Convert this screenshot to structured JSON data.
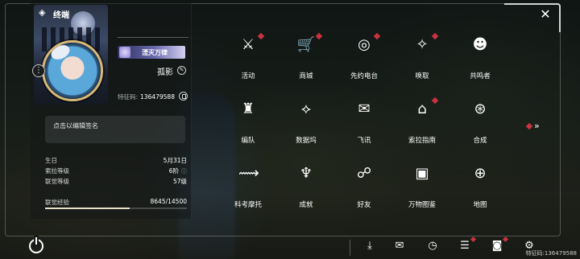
{
  "profile": {
    "title": "终端",
    "badge": "湮灭万律",
    "name": "孤影",
    "uid_label": "特征码:",
    "uid_value": "136479588",
    "signature_placeholder": "点击以编辑签名",
    "stats": [
      {
        "label": "生日",
        "value": "5月31日"
      },
      {
        "label": "索拉等级",
        "value": "6阶"
      },
      {
        "label": "联觉等级",
        "value": "57级"
      }
    ],
    "xp": {
      "label": "联觉经验",
      "value": "8645/14500",
      "fraction": 0.596
    }
  },
  "menu": {
    "items": [
      {
        "label": "活动",
        "icon": "activity-icon",
        "glyph": "⚔",
        "dot": true
      },
      {
        "label": "商城",
        "icon": "shop-cart-icon",
        "glyph": "🛒",
        "dot": true
      },
      {
        "label": "先约电台",
        "icon": "radio-icon",
        "glyph": "◎",
        "dot": true
      },
      {
        "label": "唤取",
        "icon": "summon-compass-icon",
        "glyph": "✧",
        "dot": true
      },
      {
        "label": "共鸣者",
        "icon": "resonator-portrait-icon",
        "glyph": "☻",
        "dot": false
      },
      {
        "label": "编队",
        "icon": "team-chess-icon",
        "glyph": "♜",
        "dot": false
      },
      {
        "label": "数据坞",
        "icon": "data-bank-icon",
        "glyph": "⟡",
        "dot": false
      },
      {
        "label": "飞讯",
        "icon": "message-icon",
        "glyph": "✉",
        "dot": false
      },
      {
        "label": "索拉指南",
        "icon": "guidebook-icon",
        "glyph": "⌂",
        "dot": true
      },
      {
        "label": "合成",
        "icon": "synthesis-icon",
        "glyph": "⊛",
        "dot": false
      },
      {
        "label": "科考摩托",
        "icon": "motorcycle-icon",
        "glyph": "⟿",
        "dot": false
      },
      {
        "label": "成就",
        "icon": "trophy-icon",
        "glyph": "♆",
        "dot": false
      },
      {
        "label": "好友",
        "icon": "handshake-icon",
        "glyph": "☍",
        "dot": false
      },
      {
        "label": "万物图鉴",
        "icon": "cards-icon",
        "glyph": "▣",
        "dot": false
      },
      {
        "label": "地图",
        "icon": "map-compass-icon",
        "glyph": "⊕",
        "dot": false
      }
    ],
    "next_arrow": "»"
  },
  "bottom": {
    "uid_text": "特征码:136479588",
    "close_glyph": "✕"
  }
}
